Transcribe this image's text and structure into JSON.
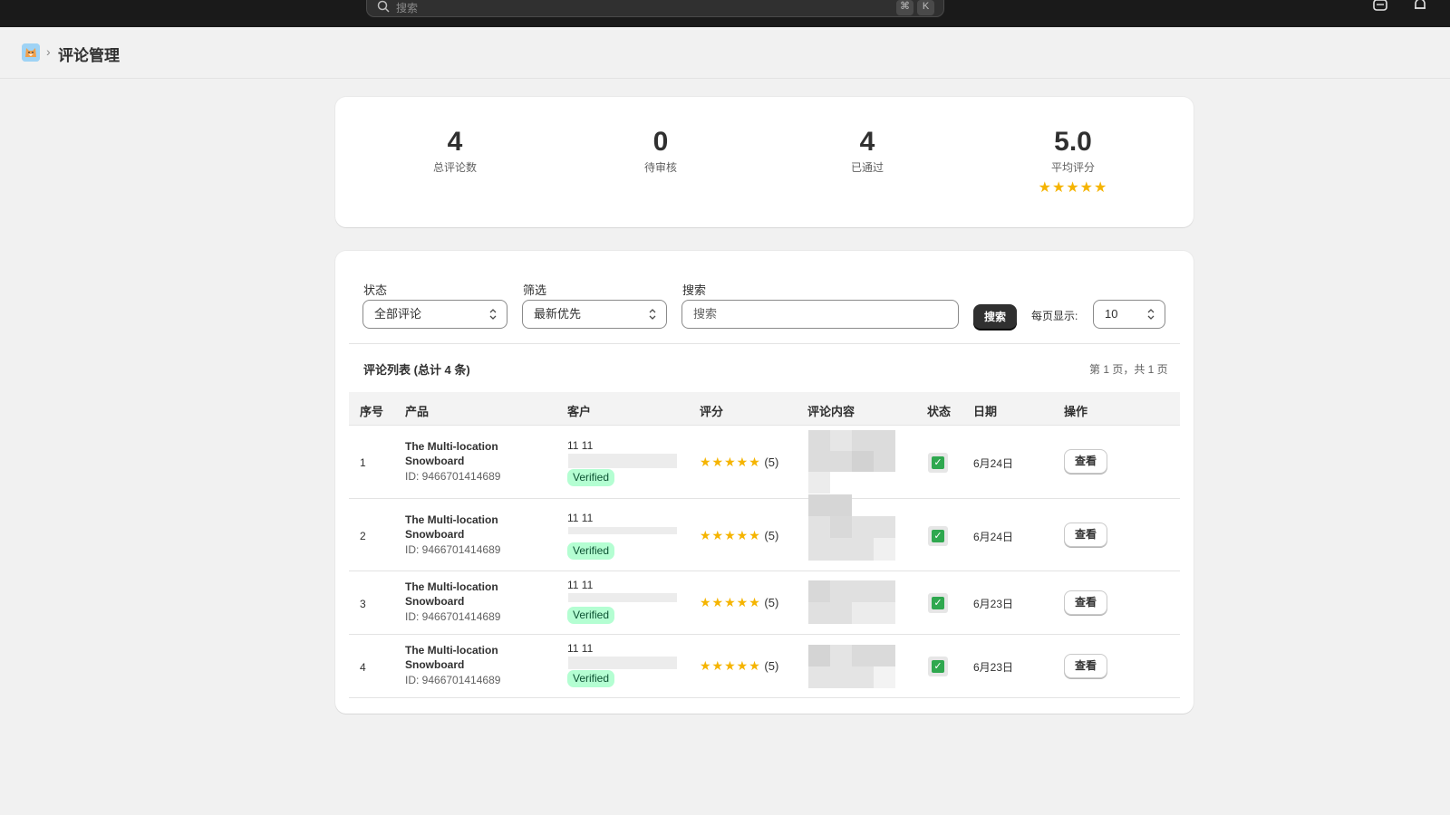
{
  "topbar": {
    "search_placeholder": "搜索",
    "shortcut_cmd": "⌘",
    "shortcut_key": "K"
  },
  "header": {
    "breadcrumb_separator": "›",
    "title": "评论管理"
  },
  "stats": [
    {
      "value": "4",
      "label": "总评论数"
    },
    {
      "value": "0",
      "label": "待审核"
    },
    {
      "value": "4",
      "label": "已通过"
    },
    {
      "value": "5.0",
      "label": "平均评分",
      "stars": "★★★★★"
    }
  ],
  "filters": {
    "status_label": "状态",
    "status_value": "全部评论",
    "sort_label": "筛选",
    "sort_value": "最新优先",
    "search_label": "搜索",
    "search_placeholder": "搜索",
    "search_button": "搜索",
    "per_page_label": "每页显示:",
    "per_page_value": "10"
  },
  "list": {
    "title": "评论列表 (总计 4 条)",
    "pager": "第 1 页，共 1 页",
    "columns": [
      "序号",
      "产品",
      "客户",
      "评分",
      "评论内容",
      "状态",
      "日期",
      "操作"
    ],
    "rows": [
      {
        "index": "1",
        "product": "The Multi-location Snowboard",
        "product_id": "ID: 9466701414689",
        "customer": "11 11",
        "badge": "Verified",
        "stars": "★★★★★",
        "rating": "(5)",
        "status": "✓",
        "date": "6月24日",
        "action": "查看"
      },
      {
        "index": "2",
        "product": "The Multi-location Snowboard",
        "product_id": "ID: 9466701414689",
        "customer": "11 11",
        "badge": "Verified",
        "stars": "★★★★★",
        "rating": "(5)",
        "status": "✓",
        "date": "6月24日",
        "action": "查看"
      },
      {
        "index": "3",
        "product": "The Multi-location Snowboard",
        "product_id": "ID: 9466701414689",
        "customer": "11 11",
        "badge": "Verified",
        "stars": "★★★★★",
        "rating": "(5)",
        "status": "✓",
        "date": "6月23日",
        "action": "查看"
      },
      {
        "index": "4",
        "product": "The Multi-location Snowboard",
        "product_id": "ID: 9466701414689",
        "customer": "11 11",
        "badge": "Verified",
        "stars": "★★★★★",
        "rating": "(5)",
        "status": "✓",
        "date": "6月23日",
        "action": "查看"
      }
    ]
  },
  "colors": {
    "topbar": "#1a1a1a",
    "star": "#f5b400",
    "badge_bg": "#b4fed2",
    "check": "#2fa84f"
  }
}
